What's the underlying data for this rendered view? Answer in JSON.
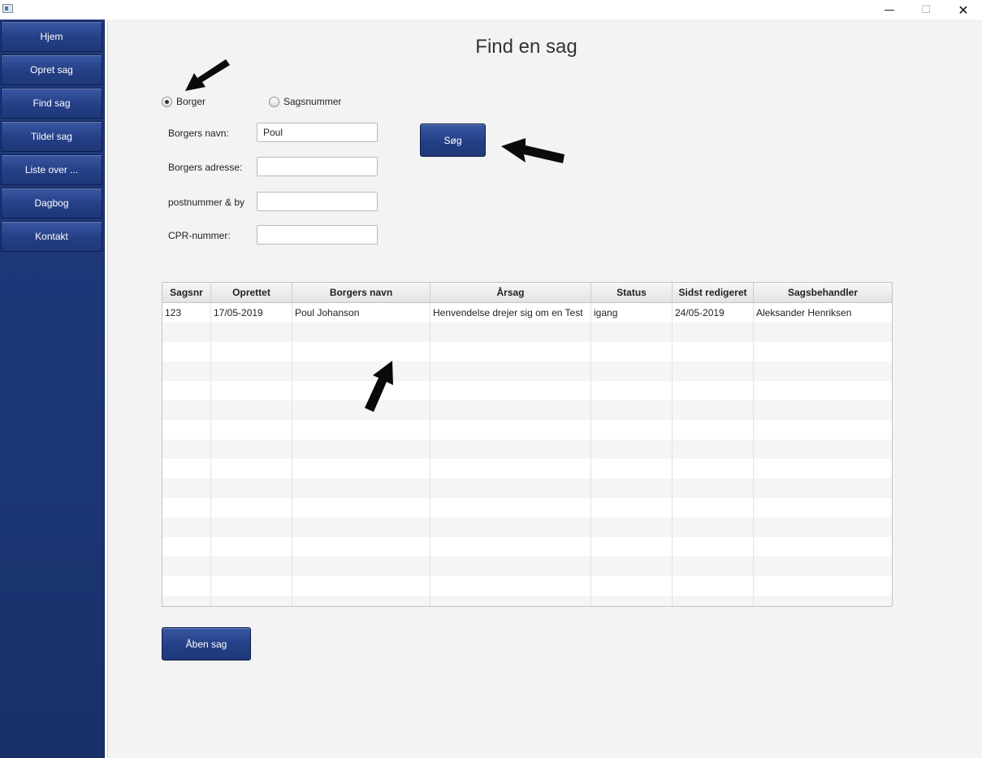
{
  "window": {
    "min_icon": "minimize-icon",
    "max_icon": "maximize-icon",
    "close_icon": "close-icon",
    "min_glyph": "—",
    "max_glyph": "☐",
    "close_glyph": "✕"
  },
  "sidebar": {
    "items": [
      {
        "label": "Hjem"
      },
      {
        "label": "Opret sag"
      },
      {
        "label": "Find sag"
      },
      {
        "label": "Tildel sag"
      },
      {
        "label": "Liste over ..."
      },
      {
        "label": "Dagbog"
      },
      {
        "label": "Kontakt"
      }
    ]
  },
  "main": {
    "title": "Find en sag",
    "radios": {
      "borger": {
        "label": "Borger",
        "selected": true
      },
      "sagsnummer": {
        "label": "Sagsnummer",
        "selected": false
      }
    },
    "fields": {
      "navn": {
        "label": "Borgers navn:",
        "value": "Poul"
      },
      "adresse": {
        "label": "Borgers adresse:",
        "value": ""
      },
      "postnummer": {
        "label": "postnummer & by",
        "value": ""
      },
      "cpr": {
        "label": "CPR-nummer:",
        "value": ""
      }
    },
    "search_button": "Søg",
    "open_button": "Åben sag"
  },
  "table": {
    "headers": [
      "Sagsnr",
      "Oprettet",
      "Borgers navn",
      "Årsag",
      "Status",
      "Sidst redigeret",
      "Sagsbehandler"
    ],
    "rows": [
      [
        "123",
        "17/05-2019",
        "Poul Johanson",
        "Henvendelse drejer sig om en Test",
        "igang",
        "24/05-2019",
        "Aleksander Henriksen"
      ]
    ]
  },
  "colors": {
    "accent": "#243f86",
    "sidebar": "#1c3674",
    "panel": "#f3f3f3"
  }
}
